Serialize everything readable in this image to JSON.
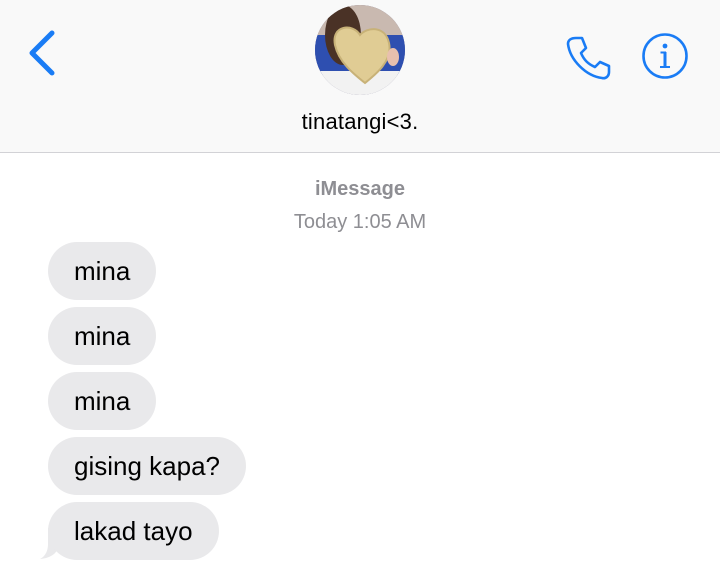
{
  "header": {
    "contact_name": "tinatangi<3.",
    "back_icon": "chevron-left-icon",
    "call_icon": "phone-icon",
    "info_icon": "info-icon",
    "accent_color": "#1a7cf5"
  },
  "conversation": {
    "service": "iMessage",
    "timestamp": "Today 1:05 AM",
    "messages": [
      {
        "text": "mina",
        "direction": "incoming"
      },
      {
        "text": "mina",
        "direction": "incoming"
      },
      {
        "text": "mina",
        "direction": "incoming"
      },
      {
        "text": "gising kapa?",
        "direction": "incoming"
      },
      {
        "text": "lakad tayo",
        "direction": "incoming"
      }
    ],
    "bubble_color": "#e9e9eb"
  }
}
